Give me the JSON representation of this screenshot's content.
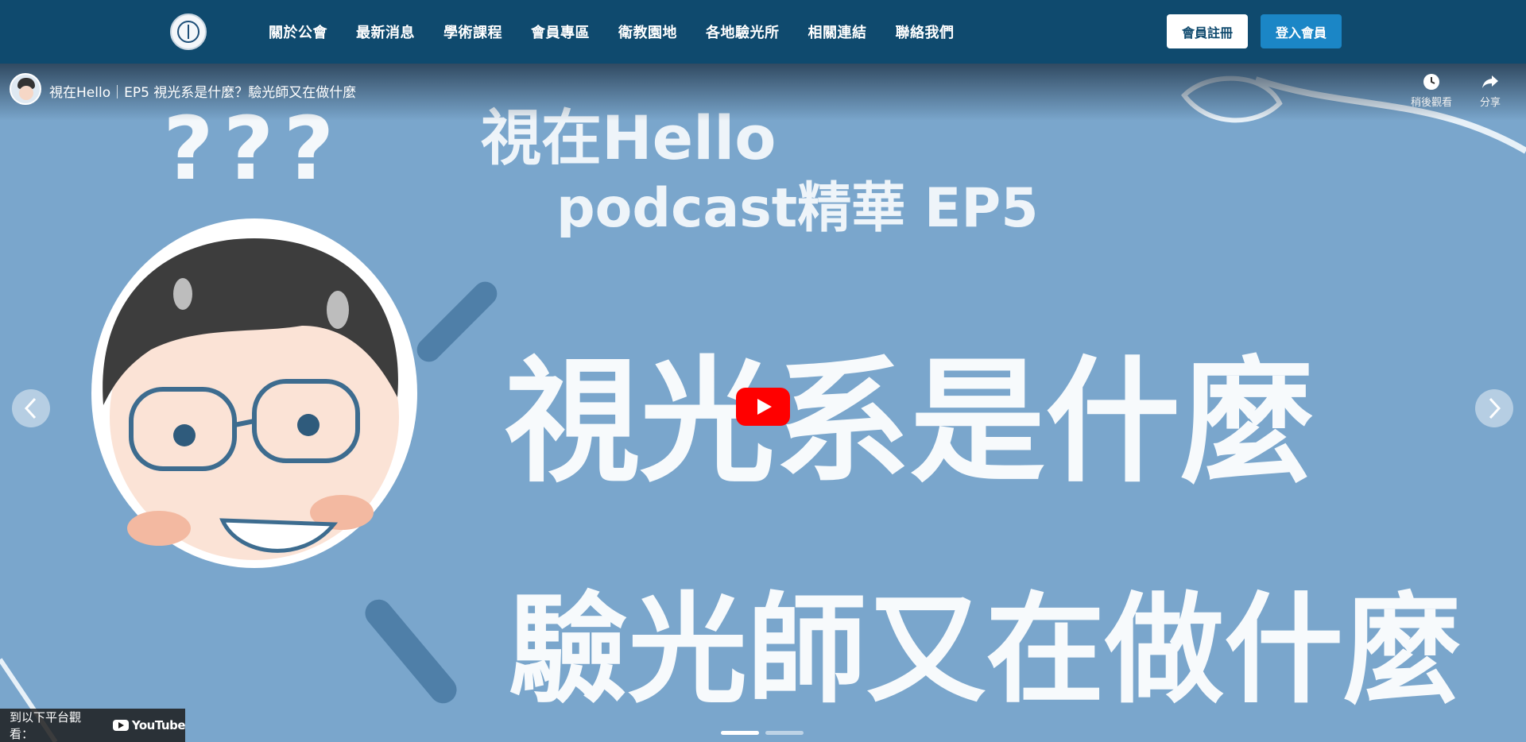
{
  "nav": {
    "logo_icon": "association-seal-logo",
    "items": [
      {
        "label": "關於公會"
      },
      {
        "label": "最新消息"
      },
      {
        "label": "學術課程"
      },
      {
        "label": "會員專區"
      },
      {
        "label": "衛教園地"
      },
      {
        "label": "各地驗光所"
      },
      {
        "label": "相關連結"
      },
      {
        "label": "聯絡我們"
      }
    ],
    "register_label": "會員註冊",
    "login_label": "登入會員"
  },
  "video": {
    "title": "視在Hello｜EP5 視光系是什麼？驗光師又在做什麼",
    "watch_later_label": "稍後觀看",
    "share_label": "分享",
    "watch_on_label": "到以下平台觀看：",
    "platform_label": "YouTube",
    "thumbnail": {
      "brand": "視在Hello",
      "podcast": "podcast精華 EP5",
      "marks": "???",
      "headline_1": "視光系是什麼",
      "headline_2": "驗光師又在做什麼"
    },
    "slides_total": 2,
    "slide_active": 1
  },
  "colors": {
    "nav_bg": "#0f4a6e",
    "login_bg": "#1b86c6",
    "thumb_bg": "#7aa6cc",
    "play_red": "#ff0000"
  }
}
